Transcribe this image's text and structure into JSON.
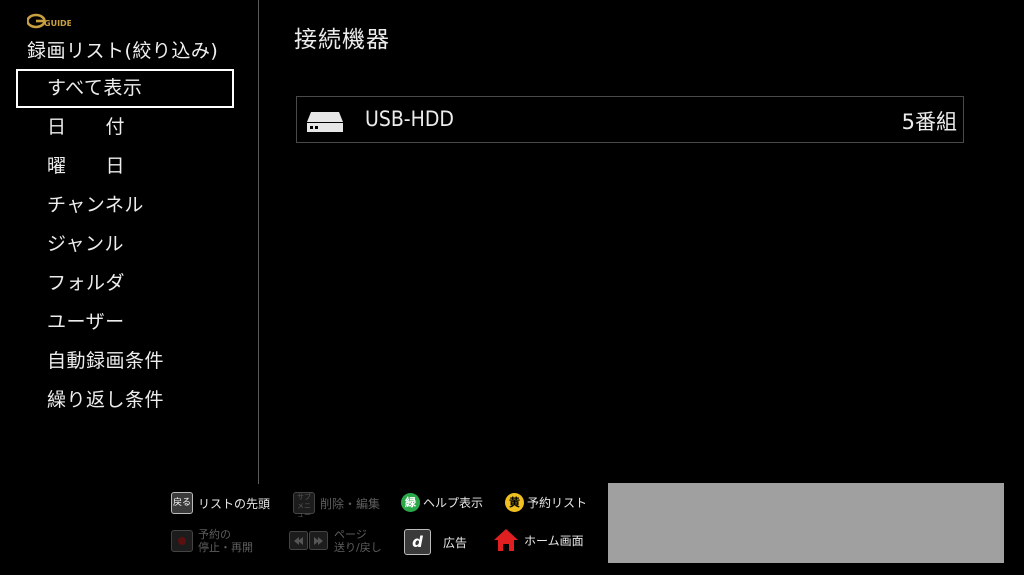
{
  "sidebar": {
    "logo_text": "GUIDE",
    "title": "録画リスト(絞り込み)",
    "items": [
      {
        "label": "すべて表示",
        "selected": true
      },
      {
        "label": "日　　付"
      },
      {
        "label": "曜　　日"
      },
      {
        "label": "チャンネル"
      },
      {
        "label": "ジャンル"
      },
      {
        "label": "フォルダ"
      },
      {
        "label": "ユーザー"
      },
      {
        "label": "自動録画条件"
      },
      {
        "label": "繰り返し条件"
      }
    ]
  },
  "main": {
    "title": "接続機器",
    "devices": [
      {
        "name": "USB-HDD",
        "count": "5番組",
        "icon": "hdd-icon"
      }
    ]
  },
  "help": {
    "back": {
      "key": "戻る",
      "label": "リストの先頭"
    },
    "submenu": {
      "key": "サブメニュー",
      "label": "削除・編集"
    },
    "green": {
      "key": "緑",
      "label": "ヘルプ表示",
      "color": "#2aa84a"
    },
    "yellow": {
      "key": "黄",
      "label": "予約リスト",
      "color": "#f0c020"
    },
    "stop": {
      "label": "予約の\n停止・再開"
    },
    "page": {
      "label": "ページ\n送り/戻し"
    },
    "ad": {
      "key": "d",
      "label": "広告"
    },
    "home": {
      "label": "ホーム画面",
      "color": "#e02020"
    }
  }
}
